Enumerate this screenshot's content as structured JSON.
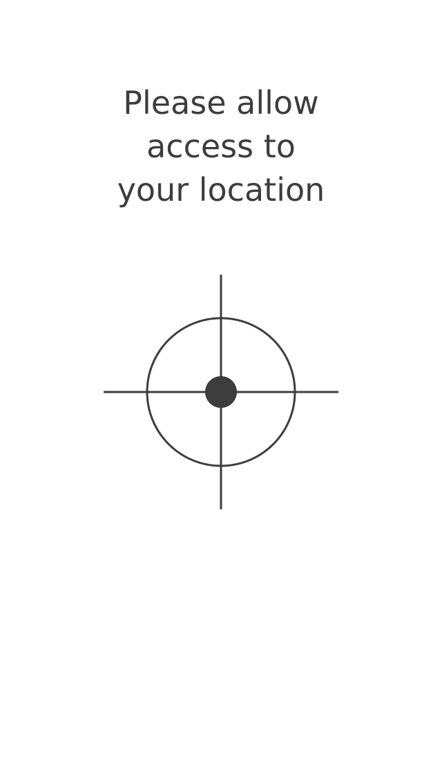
{
  "permission_prompt": {
    "lines": [
      "Please allow",
      "access to",
      "your location"
    ]
  },
  "icon": {
    "name": "location-crosshair-icon",
    "color": "#3d3d3d"
  },
  "colors": {
    "background": "#ffffff",
    "text": "#3d3d3d"
  }
}
